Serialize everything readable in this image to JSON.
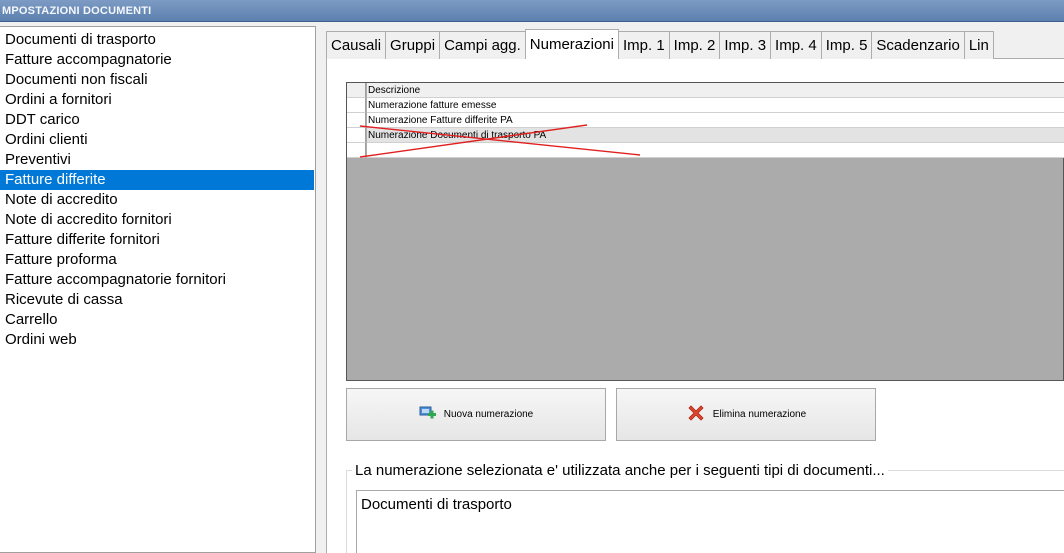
{
  "window": {
    "title": "MPOSTAZIONI DOCUMENTI"
  },
  "sidebar": {
    "items": [
      {
        "label": "Documenti di trasporto"
      },
      {
        "label": "Fatture accompagnatorie"
      },
      {
        "label": "Documenti non fiscali"
      },
      {
        "label": "Ordini a fornitori"
      },
      {
        "label": "DDT carico"
      },
      {
        "label": "Ordini clienti"
      },
      {
        "label": "Preventivi"
      },
      {
        "label": "Fatture differite",
        "selected": true
      },
      {
        "label": "Note di accredito"
      },
      {
        "label": "Note di accredito fornitori"
      },
      {
        "label": "Fatture differite fornitori"
      },
      {
        "label": "Fatture proforma"
      },
      {
        "label": "Fatture accompagnatorie fornitori"
      },
      {
        "label": "Ricevute di cassa"
      },
      {
        "label": "Carrello"
      },
      {
        "label": "Ordini web"
      }
    ]
  },
  "tabs": [
    {
      "label": "Causali"
    },
    {
      "label": "Gruppi"
    },
    {
      "label": "Campi agg."
    },
    {
      "label": "Numerazioni",
      "active": true
    },
    {
      "label": "Imp. 1"
    },
    {
      "label": "Imp. 2"
    },
    {
      "label": "Imp. 3"
    },
    {
      "label": "Imp. 4"
    },
    {
      "label": "Imp. 5"
    },
    {
      "label": "Scadenzario"
    },
    {
      "label": "Lin"
    }
  ],
  "grid": {
    "column_header": "Descrizione",
    "rows": [
      {
        "descrizione": "Numerazione fatture emesse"
      },
      {
        "descrizione": "Numerazione Fatture differite PA"
      },
      {
        "descrizione": "Numerazione Documenti di trasporto PA",
        "selected": true
      },
      {
        "descrizione": ""
      }
    ]
  },
  "buttons": {
    "new_label": "Nuova numerazione",
    "delete_label": "Elimina numerazione"
  },
  "usage": {
    "legend": "La numerazione selezionata e' utilizzata anche per i seguenti tipi di documenti...",
    "value": "Documenti di trasporto"
  },
  "colors": {
    "selection": "#0078d7",
    "annotation": "#e02020",
    "grid_background": "#ababab"
  }
}
